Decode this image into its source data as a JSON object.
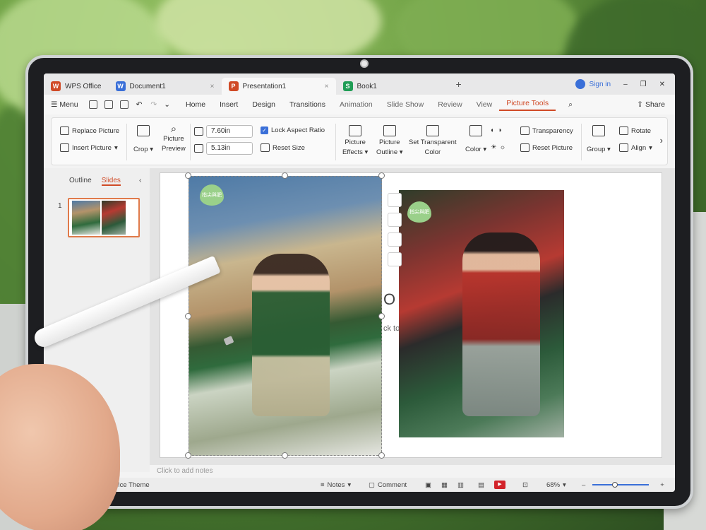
{
  "tabs": [
    {
      "label": "WPS Office",
      "logo": "W",
      "color": "#d04a26"
    },
    {
      "label": "Document1",
      "logo": "W",
      "color": "#3a6fd8"
    },
    {
      "label": "Presentation1",
      "logo": "P",
      "color": "#d04a26"
    },
    {
      "label": "Book1",
      "logo": "S",
      "color": "#1f9d55"
    }
  ],
  "titlebar": {
    "sign_in": "Sign in",
    "share": "Share"
  },
  "menu": {
    "menu_label": "Menu",
    "items": [
      "Home",
      "Insert",
      "Design",
      "Transitions",
      "Animation",
      "Slide Show",
      "Review",
      "View",
      "Picture Tools"
    ],
    "active": "Picture Tools"
  },
  "ribbon": {
    "replace_picture": "Replace Picture",
    "insert_picture": "Insert Picture",
    "crop": "Crop",
    "picture_preview_1": "Picture",
    "picture_preview_2": "Preview",
    "width_value": "7.60in",
    "height_value": "5.13in",
    "lock_aspect": "Lock Aspect Ratio",
    "reset_size": "Reset Size",
    "picture_effects_1": "Picture",
    "picture_effects_2": "Effects",
    "picture_outline_1": "Picture",
    "picture_outline_2": "Outline",
    "set_transparent_1": "Set Transparent",
    "set_transparent_2": "Color",
    "color": "Color",
    "transparency": "Transparency",
    "reset_picture": "Reset Picture",
    "group": "Group",
    "rotate": "Rotate",
    "align": "Align"
  },
  "leftpane": {
    "outline": "Outline",
    "slides": "Slides",
    "slide_number": "1"
  },
  "slide": {
    "title_fragment": "O",
    "subtitle_fragment": "ck to",
    "heart_text": "指尖與肥"
  },
  "notes": {
    "placeholder": "Click to add notes"
  },
  "status": {
    "theme": "Office Theme",
    "notes": "Notes",
    "comment": "Comment",
    "zoom": "68%"
  }
}
